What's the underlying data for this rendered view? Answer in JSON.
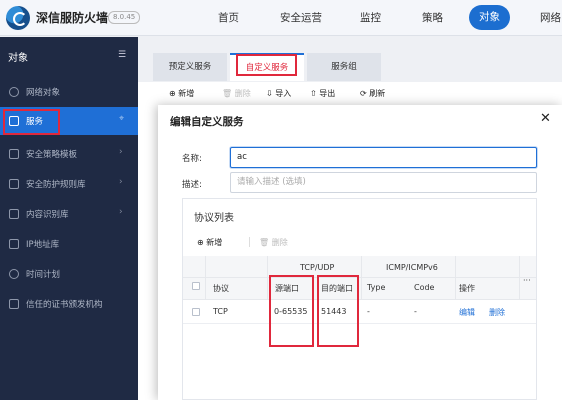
{
  "app": {
    "title": "深信服防火墙",
    "version": "8.0.45"
  },
  "nav": [
    "首页",
    "安全运营",
    "监控",
    "策略",
    "对象",
    "网络"
  ],
  "sidebar": {
    "title": "对象",
    "items": [
      {
        "label": "网络对象"
      },
      {
        "label": "服务"
      },
      {
        "label": "安全策略模板"
      },
      {
        "label": "安全防护规则库"
      },
      {
        "label": "内容识别库"
      },
      {
        "label": "IP地址库"
      },
      {
        "label": "时间计划"
      },
      {
        "label": "信任的证书颁发机构"
      }
    ]
  },
  "tabs": [
    "预定义服务",
    "自定义服务",
    "服务组"
  ],
  "toolbar": {
    "add": "新增",
    "delete": "删除",
    "import": "导入",
    "export": "导出",
    "refresh": "刷新"
  },
  "dialog": {
    "title": "编辑自定义服务",
    "name_label": "名称:",
    "name_value": "ac",
    "desc_label": "描述:",
    "desc_placeholder": "请输入描述 (选填)",
    "protocol_list_title": "协议列表",
    "proto_add": "新增",
    "proto_delete": "删除",
    "table": {
      "group_tcpudp": "TCP/UDP",
      "group_icmp": "ICMP/ICMPv6",
      "col_protocol": "协议",
      "col_src_port": "源端口",
      "col_dst_port": "目的端口",
      "col_type": "Type",
      "col_code": "Code",
      "col_ops": "操作",
      "col_more": "···",
      "rows": [
        {
          "protocol": "TCP",
          "src_port": "0-65535",
          "dst_port": "51443",
          "type": "-",
          "code": "-",
          "edit": "编辑",
          "delete": "删除"
        }
      ]
    }
  }
}
